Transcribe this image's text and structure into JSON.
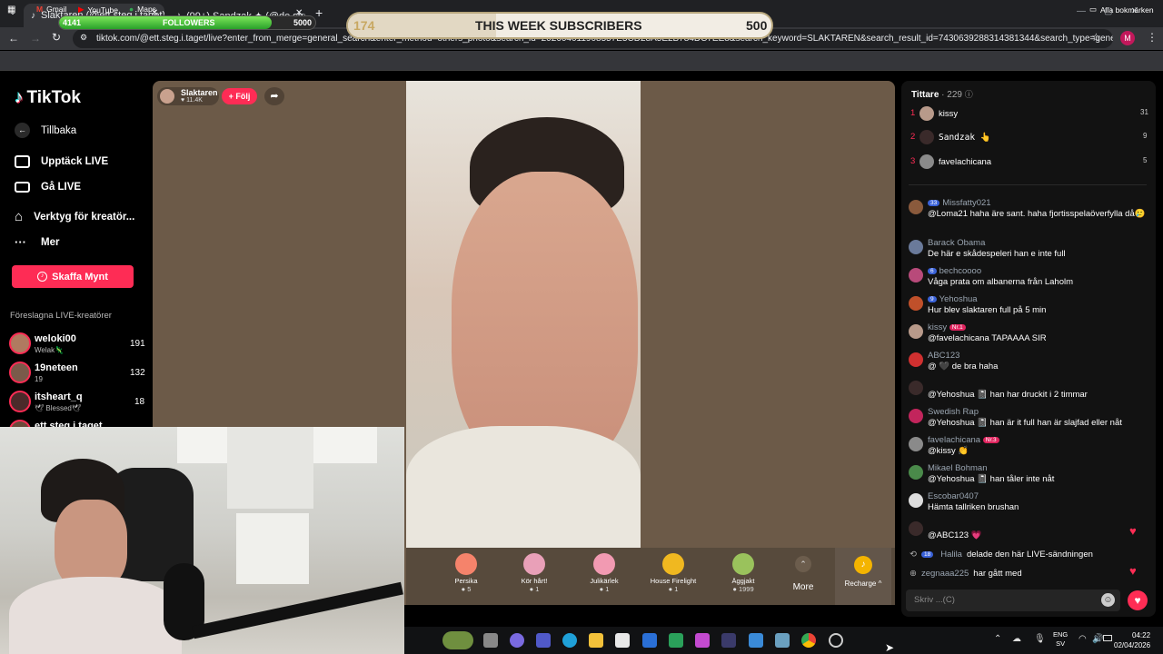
{
  "browser": {
    "tabs": [
      {
        "label": "Slaktaren (@ett.steg.i.taget)",
        "active": true
      },
      {
        "label": "(99+) Sandzak ✦ (@de.strange...",
        "active": false
      }
    ],
    "url": "tiktok.com/@ett.steg.i.taget/live?enter_from_merge=general_search&enter_method=others_photo&search_id=202604011908557E5CD28A5E2B784DC7EE8&search_keyword=SLAKTAREN&search_result_id=7430639288314381344&search_type=general",
    "profile_initial": "M",
    "bookmarks": [
      "Gmail",
      "YouTube",
      "Maps"
    ],
    "all_bookmarks": "Alla bokmärken"
  },
  "overlay": {
    "followers_current": "4141",
    "followers_label": "FOLLOWERS",
    "followers_goal": "5000",
    "followers_progress": 0.83,
    "subs_current": "174",
    "subs_label": "THIS WEEK SUBSCRIBERS",
    "subs_goal": "500",
    "subs_progress": 0.35
  },
  "sidebar": {
    "logo": "TikTok",
    "back": "Tillbaka",
    "items": [
      {
        "label": "Upptäck LIVE",
        "icon": "tv-icon"
      },
      {
        "label": "Gå LIVE",
        "icon": "camera-icon"
      },
      {
        "label": "Verktyg för kreatör...",
        "icon": "home-tool-icon"
      },
      {
        "label": "Mer",
        "icon": "more-icon"
      }
    ],
    "coins_button": "Skaffa Mynt",
    "suggested_title": "Föreslagna LIVE-kreatörer",
    "creators": [
      {
        "name": "weloki00",
        "sub": "Welak🦎",
        "count": "191"
      },
      {
        "name": "19neteen",
        "sub": "19",
        "count": "132"
      },
      {
        "name": "itsheart_q",
        "sub": "🕊 Blessed🕊",
        "count": "18"
      },
      {
        "name": "ett.steg.i.taget",
        "sub": "",
        "count": ""
      }
    ]
  },
  "stream": {
    "host_name": "Slaktaren",
    "host_likes": "11.4K",
    "follow_label": "+ Följ",
    "gifts": [
      {
        "name": "Persika",
        "price": "5",
        "color": "#f5836b"
      },
      {
        "name": "Kör hårt!",
        "price": "1",
        "color": "#e9a0b8"
      },
      {
        "name": "Julikärlek",
        "price": "1",
        "color": "#f29ab2"
      },
      {
        "name": "House Firelight",
        "price": "1",
        "color": "#f0b820"
      },
      {
        "name": "Äggjakt",
        "price": "1999",
        "color": "#9ac25c"
      }
    ],
    "more_label": "More",
    "recharge_label": "Recharge ^"
  },
  "chat": {
    "viewers_label": "Tittare",
    "viewers_count": "· 229",
    "top_viewers": [
      {
        "rank": "1",
        "name": "kissy",
        "score": "31"
      },
      {
        "rank": "2",
        "name": "Sandzak 👆",
        "score": "9"
      },
      {
        "rank": "3",
        "name": "favelachicana",
        "score": "5"
      }
    ],
    "messages": [
      {
        "user": "Missfatty021",
        "badge": "33",
        "text": "@Loma21 haha äre sant. haha fjortisspelaöverfylla då🥲",
        "color": "#8a5a3c",
        "heart": false
      },
      {
        "user": "Barack Obama",
        "badge": "",
        "text": "De här e skådespeleri han e inte full",
        "color": "#6a7a9a",
        "heart": false
      },
      {
        "user": "bechcoooo",
        "badge": "6",
        "text": "Våga prata om albanerna från Laholm",
        "color": "#b84a7a",
        "heart": false
      },
      {
        "user": "Yehoshua",
        "badge": "9",
        "text": "Hur blev slaktaren full på 5 min",
        "color": "#c0502a",
        "heart": false
      },
      {
        "user": "kissy",
        "badge": "Nr.1",
        "text": "@favelachicana TAPAAAA SIR",
        "color": "#b89a8a",
        "heart": false
      },
      {
        "user": "ABC123",
        "badge": "",
        "text": "@ 🖤 de bra haha",
        "color": "#d03030",
        "heart": false
      },
      {
        "user": "",
        "badge": "",
        "text": "@Yehoshua 📓 han har druckit i 2 timmar",
        "color": "#3a2a2a",
        "heart": false
      },
      {
        "user": "Swedish Rap",
        "badge": "",
        "text": "@Yehoshua 📓 han är it full han är slajfad eller nåt",
        "color": "#c2255c",
        "heart": false
      },
      {
        "user": "favelachicana",
        "badge": "Nr.3",
        "text": "@kissy 👏",
        "color": "#8a8a8a",
        "heart": false
      },
      {
        "user": "Mikael Bohman",
        "badge": "",
        "text": "@Yehoshua 📓 han tåler inte nåt",
        "color": "#4a8a4a",
        "heart": false
      },
      {
        "user": "Escobar0407",
        "badge": "",
        "text": "Hämta tallriken brushan",
        "color": "#dddddd",
        "heart": false
      },
      {
        "user": "",
        "badge": "",
        "text": "@ABC123 💗",
        "color": "#3a2a2a",
        "heart": true
      }
    ],
    "share_event": {
      "badge": "18",
      "user": "Halila",
      "text": "delade den här LIVE-sändningen"
    },
    "join_event": {
      "user": "zegnaaa225",
      "text": "har gått med"
    },
    "input_placeholder": "Skriv ...(C)"
  },
  "taskbar": {
    "lang": "ENG",
    "region": "SV",
    "time": "04:22",
    "date": "02/04/2026"
  }
}
